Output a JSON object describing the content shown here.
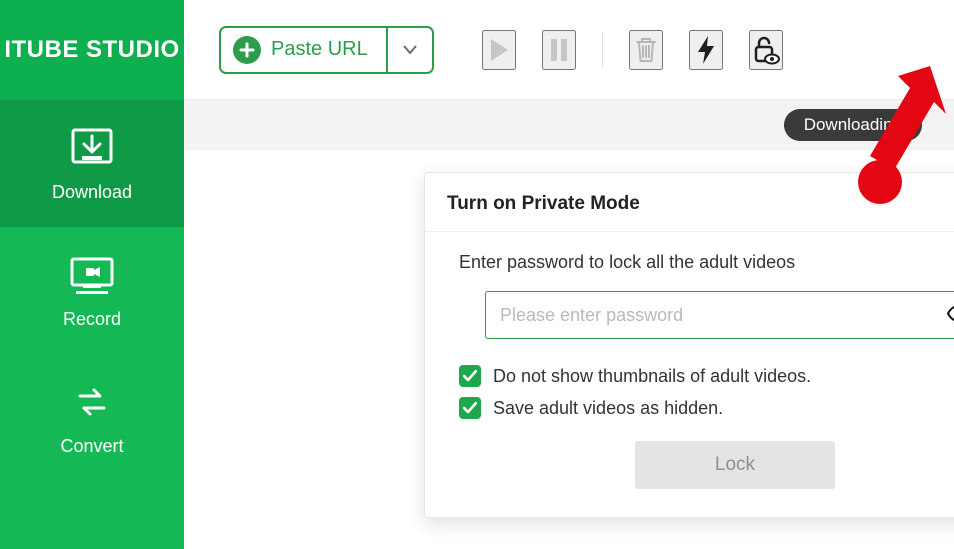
{
  "brand": "ITUBE STUDIO",
  "sidebar": {
    "items": [
      {
        "label": "Download"
      },
      {
        "label": "Record"
      },
      {
        "label": "Convert"
      }
    ]
  },
  "toolbar": {
    "paste_label": "Paste URL"
  },
  "status": {
    "badge": "Downloading"
  },
  "modal": {
    "title": "Turn on Private Mode",
    "prompt": "Enter password to lock all the adult videos",
    "password_placeholder": "Please enter password",
    "option_hide_thumbs": "Do not show thumbnails of adult videos.",
    "option_save_hidden": "Save adult videos as hidden.",
    "lock_label": "Lock"
  }
}
